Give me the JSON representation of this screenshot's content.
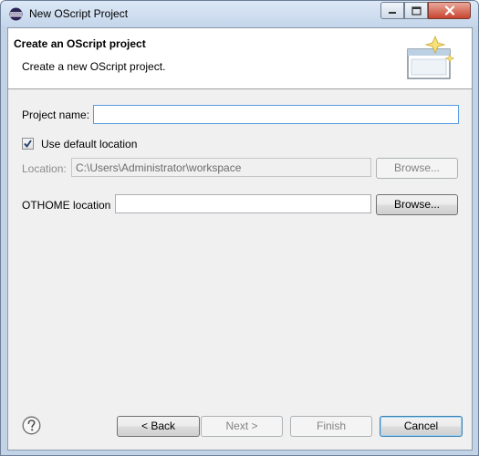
{
  "window": {
    "title": "New OScript Project"
  },
  "header": {
    "title": "Create an OScript project",
    "description": "Create a new OScript project."
  },
  "form": {
    "project_name_label": "Project name:",
    "project_name_value": "",
    "use_default_location_label": "Use default location",
    "use_default_location_checked": true,
    "location_label": "Location:",
    "location_value": "C:\\Users\\Administrator\\workspace",
    "location_browse_label": "Browse...",
    "othome_label": "OTHOME location",
    "othome_value": "",
    "othome_browse_label": "Browse..."
  },
  "footer": {
    "back_label": "< Back",
    "next_label": "Next >",
    "finish_label": "Finish",
    "cancel_label": "Cancel"
  },
  "icons": {
    "app": "eclipse-icon",
    "banner": "wizard-banner-icon",
    "help": "help-icon",
    "minimize": "minimize-icon",
    "maximize": "maximize-icon",
    "close": "close-icon"
  }
}
